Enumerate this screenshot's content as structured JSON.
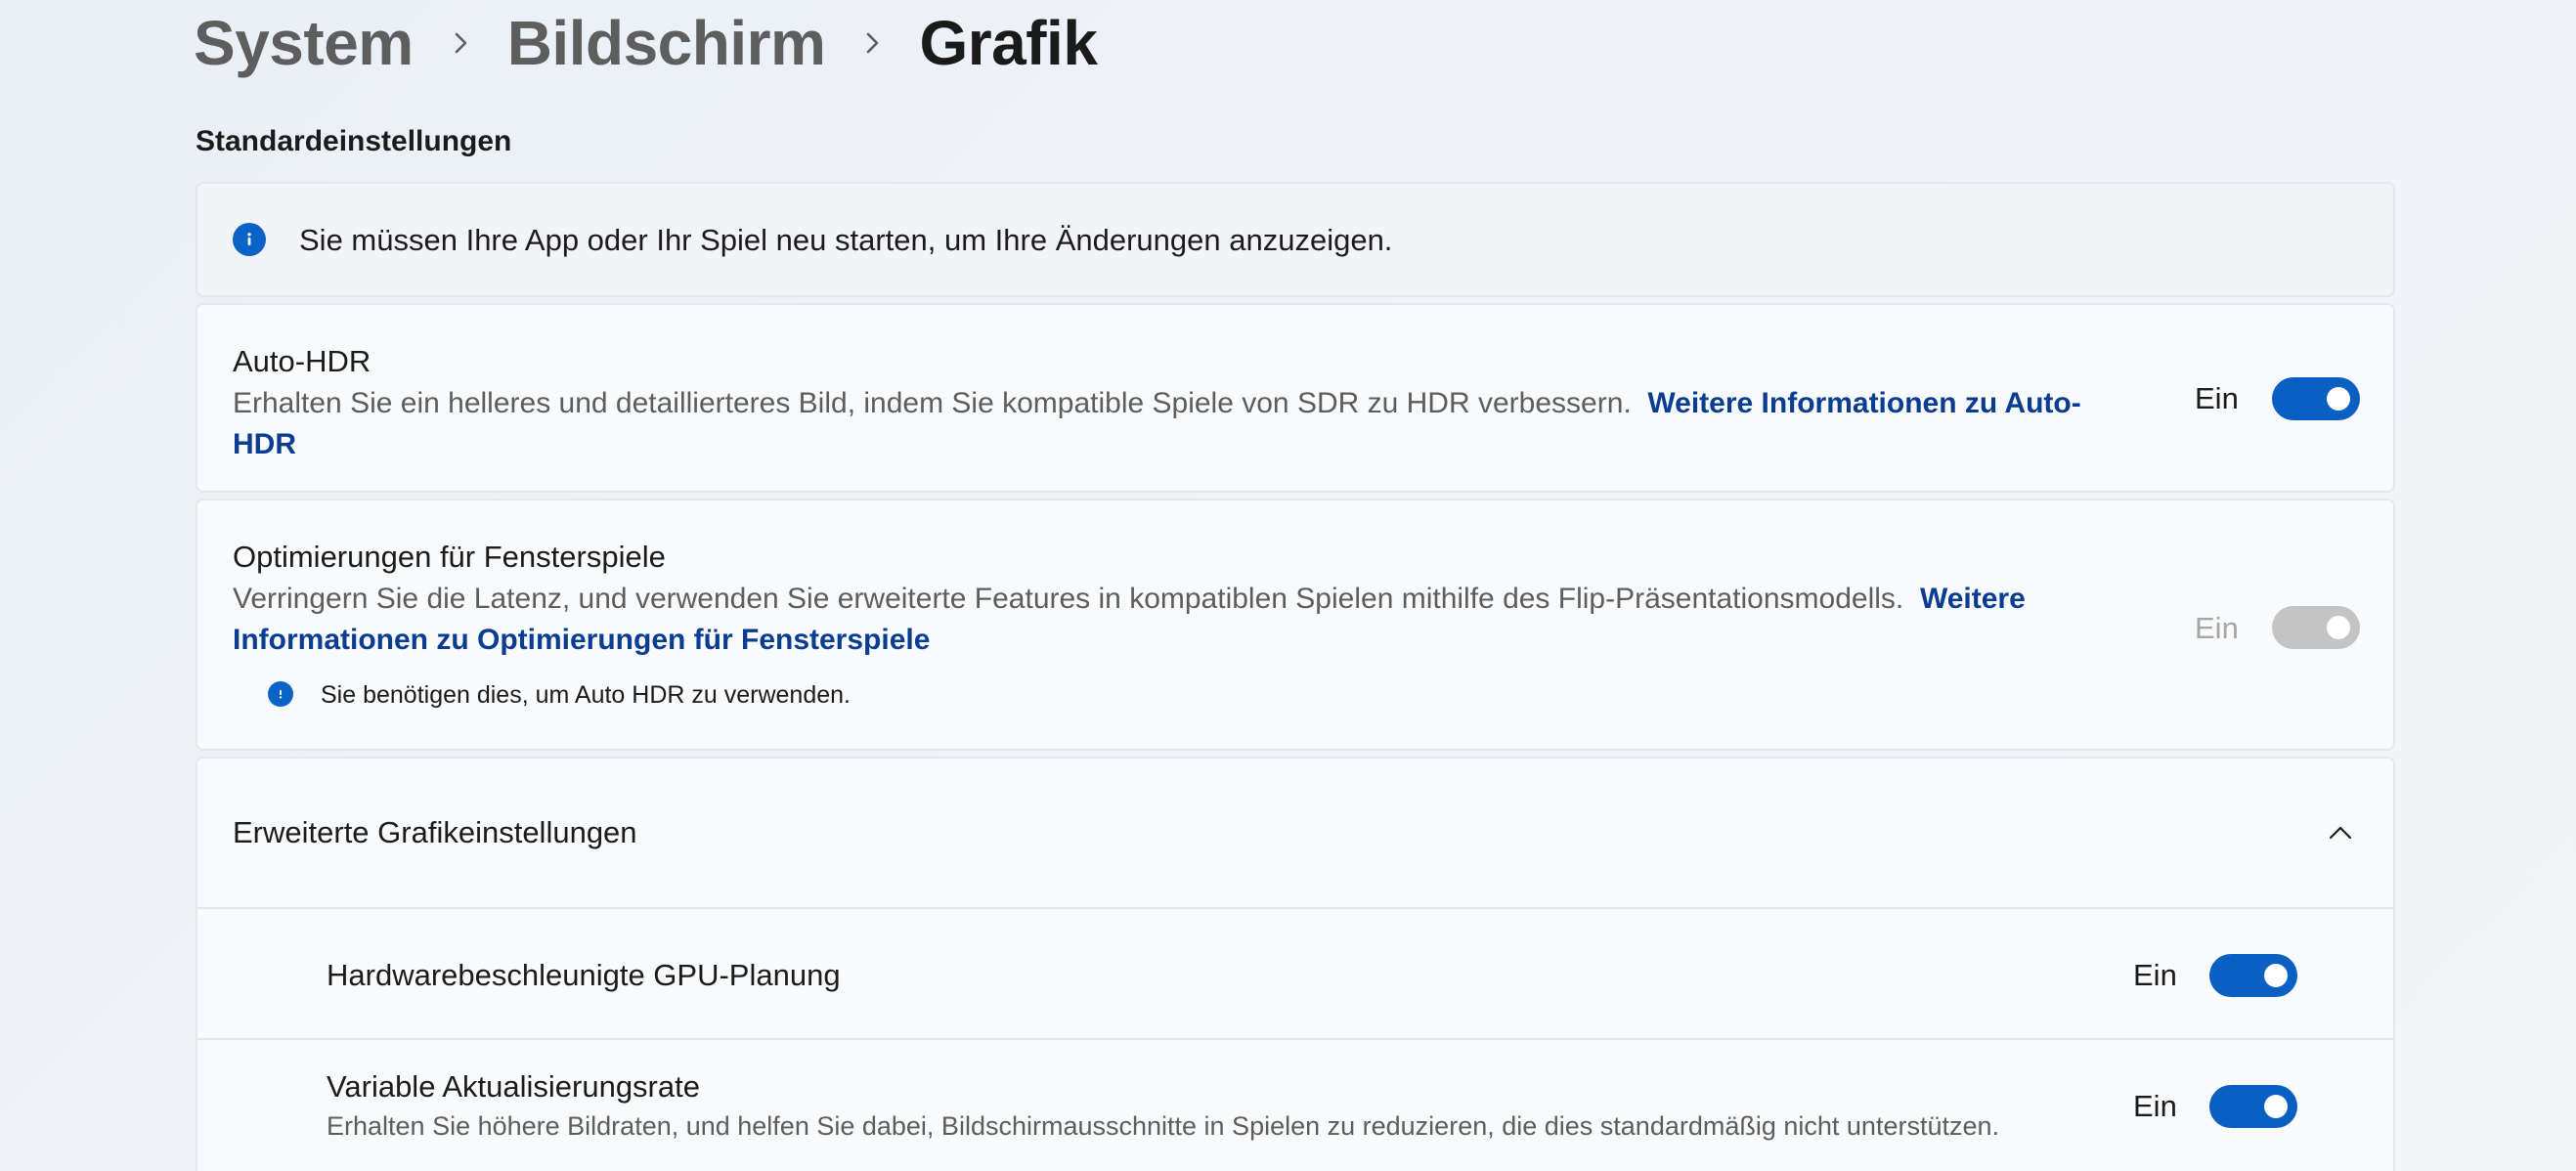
{
  "breadcrumb": {
    "items": [
      "System",
      "Bildschirm",
      "Grafik"
    ]
  },
  "section": {
    "title": "Standardeinstellungen"
  },
  "info_bar": {
    "icon": "info-icon",
    "text": "Sie müssen Ihre App oder Ihr Spiel neu starten, um Ihre Änderungen anzuzeigen."
  },
  "auto_hdr": {
    "title": "Auto-HDR",
    "description": "Erhalten Sie ein helleres und detaillierteres Bild, indem Sie kompatible Spiele von SDR zu HDR verbessern.",
    "link_line1": "Weitere Informationen zu Auto-",
    "link_line2": "HDR",
    "state_label": "Ein",
    "toggle_on": true
  },
  "windowed_games": {
    "title": "Optimierungen für Fensterspiele",
    "description": "Verringern Sie die Latenz, und verwenden Sie erweiterte Features in kompatiblen Spielen mithilfe des Flip-Präsentationsmodells.",
    "link_line1": "Weitere",
    "link_line2": "Informationen zu Optimierungen für Fensterspiele",
    "note": "Sie benötigen dies, um Auto HDR zu verwenden.",
    "state_label": "Ein",
    "toggle_on": true,
    "disabled": true
  },
  "advanced": {
    "title": "Erweiterte Grafikeinstellungen",
    "expanded": true,
    "items": [
      {
        "title": "Hardwarebeschleunigte GPU-Planung",
        "state_label": "Ein",
        "toggle_on": true
      },
      {
        "title": "Variable Aktualisierungsrate",
        "description": "Erhalten Sie höhere Bildraten, und helfen Sie dabei, Bildschirmausschnitte in Spielen zu reduzieren, die dies standardmäßig nicht unterstützen.",
        "state_label": "Ein",
        "toggle_on": true
      }
    ]
  },
  "colors": {
    "accent": "#0a5fc2",
    "link": "#0a3d91",
    "disabled_toggle": "#c4c4c4"
  }
}
